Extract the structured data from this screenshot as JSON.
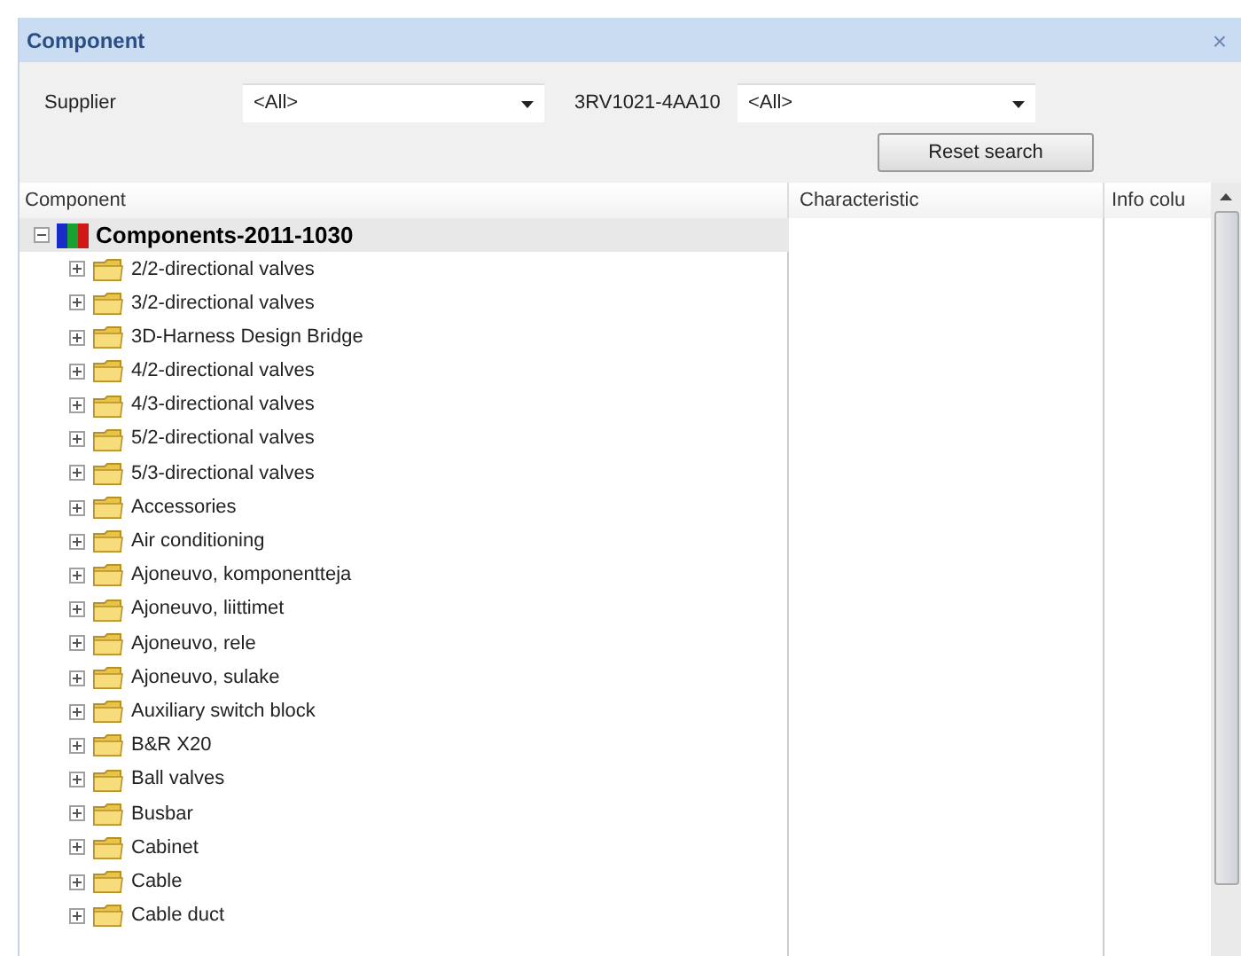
{
  "window": {
    "title": "Component",
    "close": "×"
  },
  "filters": {
    "supplier_label": "Supplier",
    "supplier_value": "<All>",
    "part_label": "3RV1021-4AA10",
    "part_value": "<All>",
    "reset_button": "Reset search"
  },
  "tree": {
    "columns": [
      "Component",
      "Characteristic",
      "Info colu"
    ],
    "root": {
      "label": "Components-2011-1030",
      "expanded": true,
      "selected": true,
      "children": [
        {
          "label": "2/2-directional valves",
          "expanded": false,
          "selected": false
        },
        {
          "label": "3/2-directional valves",
          "expanded": false,
          "selected": false
        },
        {
          "label": "3D-Harness Design Bridge",
          "expanded": false,
          "selected": false
        },
        {
          "label": "4/2-directional valves",
          "expanded": false,
          "selected": false
        },
        {
          "label": "4/3-directional valves",
          "expanded": false,
          "selected": false
        },
        {
          "label": "5/2-directional valves",
          "expanded": false,
          "selected": false
        },
        {
          "label": "5/3-directional valves",
          "expanded": false,
          "selected": false
        },
        {
          "label": "Accessories",
          "expanded": false,
          "selected": false
        },
        {
          "label": "Air conditioning",
          "expanded": false,
          "selected": false
        },
        {
          "label": "Ajoneuvo, komponentteja",
          "expanded": false,
          "selected": false
        },
        {
          "label": "Ajoneuvo, liittimet",
          "expanded": false,
          "selected": false
        },
        {
          "label": "Ajoneuvo, rele",
          "expanded": false,
          "selected": false
        },
        {
          "label": "Ajoneuvo, sulake",
          "expanded": false,
          "selected": false
        },
        {
          "label": "Auxiliary switch block",
          "expanded": false,
          "selected": false
        },
        {
          "label": "B&R X20",
          "expanded": false,
          "selected": false
        },
        {
          "label": "Ball valves",
          "expanded": false,
          "selected": false
        },
        {
          "label": "Busbar",
          "expanded": false,
          "selected": false
        },
        {
          "label": "Cabinet",
          "expanded": false,
          "selected": false
        },
        {
          "label": "Cable",
          "expanded": false,
          "selected": false
        },
        {
          "label": "Cable duct",
          "expanded": false,
          "selected": false
        }
      ]
    }
  }
}
